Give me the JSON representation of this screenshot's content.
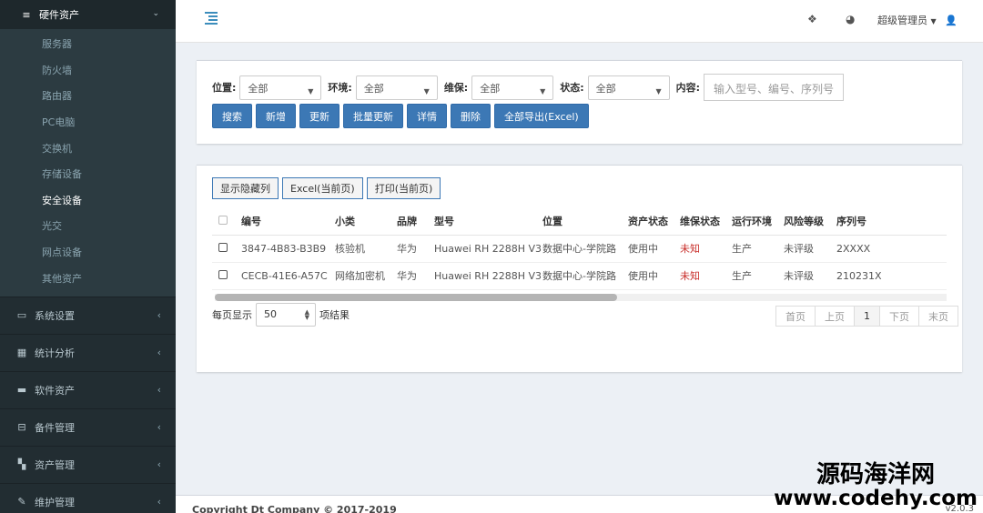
{
  "sidebar": {
    "header": {
      "label": "硬件资产",
      "icon": "database-icon"
    },
    "sub_items": [
      "服务器",
      "防火墙",
      "路由器",
      "PC电脑",
      "交换机",
      "存储设备",
      "安全设备",
      "光交",
      "网点设备",
      "其他资产"
    ],
    "active_sub": "安全设备",
    "items": [
      {
        "label": "系统设置",
        "icon": "laptop-icon"
      },
      {
        "label": "统计分析",
        "icon": "table-icon"
      },
      {
        "label": "软件资产",
        "icon": "hdd-icon"
      },
      {
        "label": "备件管理",
        "icon": "inbox-icon"
      },
      {
        "label": "资产管理",
        "icon": "grid-icon"
      },
      {
        "label": "维护管理",
        "icon": "wrench-icon"
      }
    ]
  },
  "topbar": {
    "user": "超级管理员",
    "icons": [
      "menu-toggle-icon",
      "dropbox-icon",
      "palette-icon",
      "user-icon"
    ]
  },
  "filters": {
    "location_label": "位置:",
    "location_value": "全部",
    "env_label": "环境:",
    "env_value": "全部",
    "maint_label": "维保:",
    "maint_value": "全部",
    "status_label": "状态:",
    "status_value": "全部",
    "content_label": "内容:",
    "content_placeholder": "输入型号、编号、序列号"
  },
  "actions": [
    "搜索",
    "新增",
    "更新",
    "批量更新",
    "详情",
    "删除",
    "全部导出(Excel)"
  ],
  "table_tools": [
    "显示隐藏列",
    "Excel(当前页)",
    "打印(当前页)"
  ],
  "table": {
    "columns": [
      "编号",
      "小类",
      "品牌",
      "型号",
      "位置",
      "资产状态",
      "维保状态",
      "运行环境",
      "风险等级",
      "序列号"
    ],
    "rows": [
      [
        "3847-4B83-B3B9",
        "核验机",
        "华为",
        "Huawei RH 2288H V3",
        "数据中心-学院路",
        "使用中",
        "未知",
        "生产",
        "未评级",
        "2XXXX"
      ],
      [
        "CECB-41E6-A57C",
        "网络加密机",
        "华为",
        "Huawei RH 2288H V3",
        "数据中心-学院路",
        "使用中",
        "未知",
        "生产",
        "未评级",
        "210231X"
      ]
    ]
  },
  "pagination": {
    "per_page_label": "每页显示",
    "per_page_value": "50",
    "suffix": "项结果",
    "first": "首页",
    "prev": "上页",
    "current": "1",
    "next": "下页",
    "last": "末页"
  },
  "footer": {
    "copyright": "Copyright Dt Company © 2017-2019",
    "version": "v2.0.3"
  },
  "watermark": {
    "line1": "源码海洋网",
    "line2": "www.codehy.com"
  },
  "colors": {
    "primary": "#3c78b5",
    "sidebar": "#222d32",
    "danger": "#c9302c"
  }
}
